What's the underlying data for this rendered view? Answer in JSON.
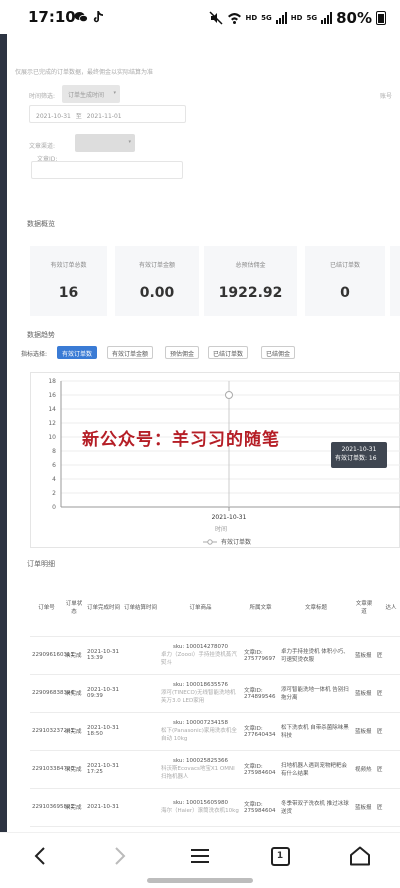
{
  "status_bar": {
    "time": "17:10",
    "battery": "80%",
    "network_labels": [
      "HD",
      "5G",
      "HD",
      "5G"
    ],
    "app_icons": [
      "wechat-icon",
      "tiktok-icon"
    ]
  },
  "filters": {
    "note": "仅展示已完成的订单数据，最终佣金以实际结算为准",
    "time_filter_label": "时间筛选:",
    "time_type_value": "订单生成时间",
    "date_range_start": "2021-10-31",
    "date_range_sep": "至",
    "date_range_end": "2021-11-01",
    "account_label": "账号",
    "channel_label": "文章渠道:",
    "article_id_label": "文章ID:"
  },
  "overview": {
    "title": "数据概览",
    "cards": [
      {
        "label": "有效订单总数",
        "value": "16"
      },
      {
        "label": "有效订单金额",
        "value": "0.00"
      },
      {
        "label": "总预估佣金",
        "value": "1922.92"
      },
      {
        "label": "已结订单数",
        "value": "0"
      }
    ]
  },
  "trend": {
    "title": "数据趋势",
    "metric_label": "指标选择:",
    "metrics": [
      "有效订单数",
      "有效订单金额",
      "预估佣金",
      "已结订单数",
      "已结佣金"
    ],
    "active_metric": "有效订单数"
  },
  "chart_data": {
    "type": "line",
    "x": [
      "2021-10-31"
    ],
    "series": [
      {
        "name": "有效订单数",
        "values": [
          16
        ]
      }
    ],
    "ylim": [
      0,
      18
    ],
    "yticks": [
      0,
      2,
      4,
      6,
      8,
      10,
      12,
      14,
      16,
      18
    ],
    "xlabel": "时间",
    "ylabel": "",
    "legend": "bottom",
    "tooltip": {
      "date": "2021-10-31",
      "text": "有效订单数: 16"
    }
  },
  "watermark": "新公众号：羊习习的随笔",
  "orders": {
    "title": "订单明细",
    "headers": [
      "订单号",
      "订单状态",
      "订单完成时间",
      "订单结算时间",
      "订单商品",
      "所属文章",
      "文章标题",
      "文章渠道",
      "达人"
    ],
    "rows": [
      {
        "order_no": "229096160311",
        "status": "未完成",
        "date": "2021-10-31",
        "time": "13:39",
        "sku": "sku: 100014278070",
        "product": "卓力（Zoooi）手持挂烫机蒸汽熨斗",
        "article_id": "文章ID: 275779697",
        "article_title": "卓力手持挂烫机 体积小巧、可速熨烫衣服",
        "channel": "蓝板报",
        "talent": "匠"
      },
      {
        "order_no": "229096838394",
        "status": "未完成",
        "date": "2021-10-31",
        "time": "09:39",
        "sku": "sku: 100018635576",
        "product": "添可(TINECO)无线智能洗地机芙万3.0 LED家用",
        "article_id": "文章ID: 274899546",
        "article_title": "添可智能洗地一体机 告别扫拖分离",
        "channel": "蓝板报",
        "talent": "匠"
      },
      {
        "order_no": "229103237241",
        "status": "未完成",
        "date": "2021-10-31",
        "time": "18:50",
        "sku": "sku: 100007234158",
        "product": "松下(Panasonic)家用洗衣机全自动 10kg",
        "article_id": "文章ID: 277640434",
        "article_title": "松下洗衣机 自带杀菌除味黑科技",
        "channel": "蓝板报",
        "talent": "匠"
      },
      {
        "order_no": "229103384720",
        "status": "未完成",
        "date": "2021-10-31",
        "time": "17:25",
        "sku": "sku: 100025825366",
        "product": "科沃斯Ecovacs地宝X1 OMNI扫拖机器人",
        "article_id": "文章ID: 275984604",
        "article_title": "扫地机器人遇到宠物粑粑会有什么结果",
        "channel": "视频热",
        "talent": "匠"
      },
      {
        "order_no": "229103695822",
        "status": "未完成",
        "date": "2021-10-31",
        "time": "",
        "sku": "sku: 100015605980",
        "product": "海尔（Haier）滚筒洗衣机10kg",
        "article_id": "文章ID: 275984604",
        "article_title": "冬季带双子洗衣机 推过冰球送货",
        "channel": "蓝板报",
        "talent": "匠"
      }
    ]
  },
  "navbar": {
    "tab_count": "1"
  }
}
